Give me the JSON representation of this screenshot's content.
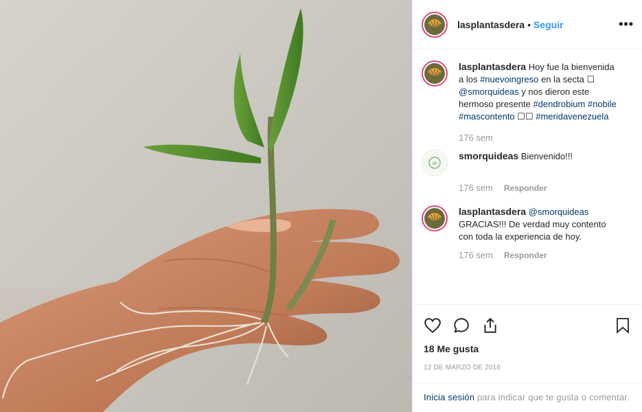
{
  "post": {
    "username": "lasplantasdera",
    "separator": "•",
    "follow_label": "Seguir",
    "more_label": "•••"
  },
  "caption": {
    "username": "lasplantasdera",
    "text_1": "Hoy fue la bienvenida a los ",
    "tag_1": "#nuevoingreso",
    "text_2": " en la secta ☐ ",
    "tag_2": "@smorquideas",
    "text_3": " y nos dieron este hermoso presente ",
    "tag_3": "#dendrobium",
    "tag_4": "#nobile",
    "tag_5": "#mascontento",
    "text_4": " ☐☐ ",
    "tag_6": "#meridavenezuela",
    "time": "176 sem"
  },
  "comments": [
    {
      "username": "smorquideas",
      "text": "Bienvenido!!!",
      "time": "176 sem",
      "reply_label": "Responder"
    },
    {
      "username": "lasplantasdera",
      "mention": "@smorquideas",
      "text": " GRACIAS!!! De verdad muy contento con toda la experiencia de hoy.",
      "time": "176 sem",
      "reply_label": "Responder"
    }
  ],
  "stats": {
    "likes": "18 Me gusta",
    "date": "12 de marzo de 2016"
  },
  "login_prompt": {
    "link": "Inicia sesión",
    "text": " para indicar que te gusta o comentar."
  },
  "icons": {
    "like": "heart-icon",
    "comment": "comment-icon",
    "share": "share-icon",
    "save": "bookmark-icon"
  },
  "colors": {
    "follow": "#3897f0",
    "hashtag": "#003569",
    "muted": "#999999",
    "story_ring": "#e0457b"
  }
}
